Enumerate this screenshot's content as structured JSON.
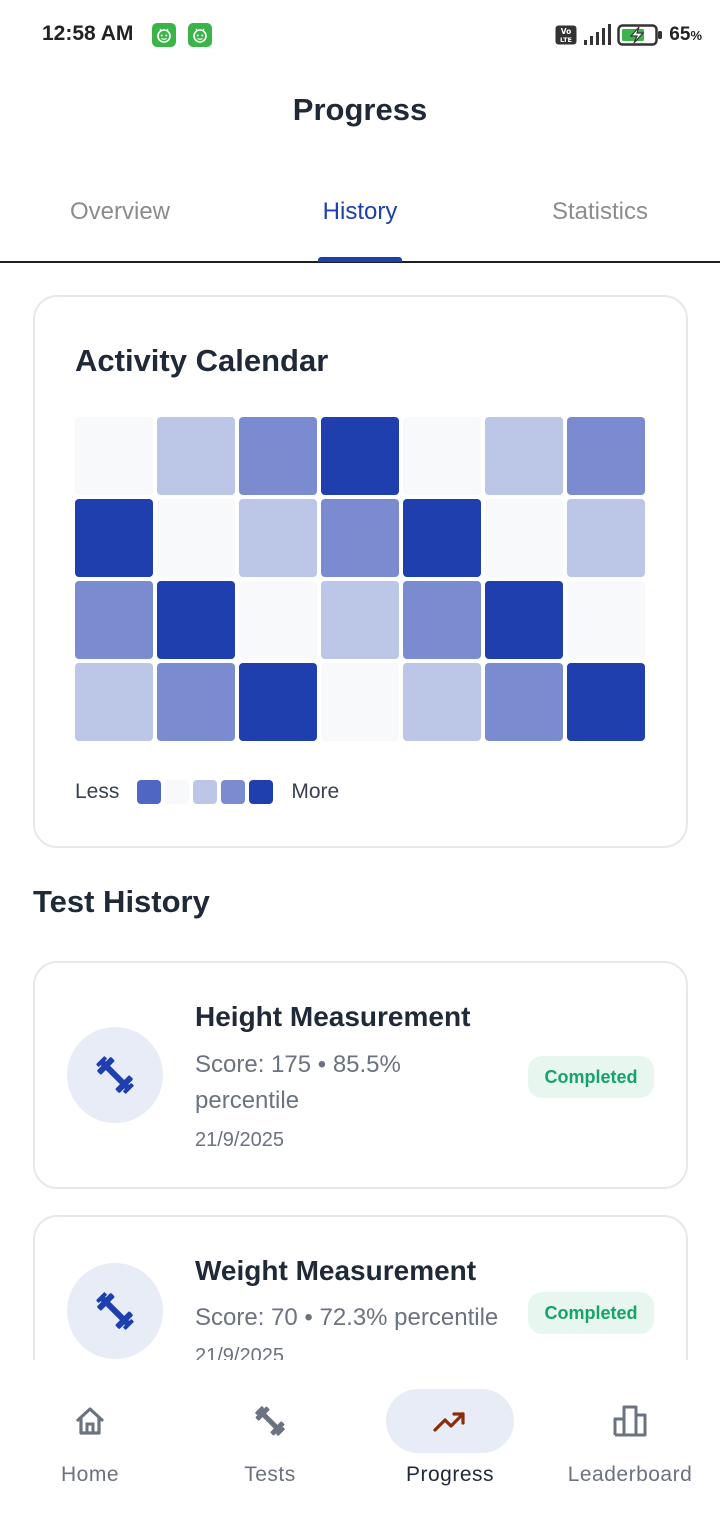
{
  "status_bar": {
    "time": "12:58 AM",
    "battery_percent": "65",
    "battery_unit": "%",
    "notification_icons": [
      "android-face-icon",
      "android-face-icon"
    ]
  },
  "header": {
    "title": "Progress"
  },
  "tabs": [
    {
      "label": "Overview",
      "active": false
    },
    {
      "label": "History",
      "active": true
    },
    {
      "label": "Statistics",
      "active": false
    }
  ],
  "activity_calendar": {
    "title": "Activity Calendar",
    "levels": [
      [
        0,
        1,
        2,
        3,
        0,
        1,
        2
      ],
      [
        3,
        0,
        1,
        2,
        3,
        0,
        1
      ],
      [
        2,
        3,
        0,
        1,
        2,
        3,
        0
      ],
      [
        1,
        2,
        3,
        0,
        1,
        2,
        3
      ]
    ],
    "level_colors": [
      "#f8f9fb",
      "#bcc6e7",
      "#7a8ccf",
      "#1f3fae"
    ],
    "legend": {
      "less_label": "Less",
      "more_label": "More",
      "swatch_colors": [
        "#4f66c2",
        "#f8f9fb",
        "#bcc6e7",
        "#7a8ccf",
        "#1f3fae"
      ]
    }
  },
  "test_history": {
    "title": "Test History",
    "items": [
      {
        "name": "Height Measurement",
        "score": "Score: 175 • 85.5% percentile",
        "date": "21/9/2025",
        "status": "Completed",
        "icon": "dumbbell-icon"
      },
      {
        "name": "Weight Measurement",
        "score": "Score: 70 • 72.3% percentile",
        "date": "21/9/2025",
        "status": "Completed",
        "icon": "dumbbell-icon"
      }
    ]
  },
  "bottom_nav": [
    {
      "label": "Home",
      "icon": "home-icon",
      "active": false
    },
    {
      "label": "Tests",
      "icon": "dumbbell-icon",
      "active": false
    },
    {
      "label": "Progress",
      "icon": "trending-up-icon",
      "active": true
    },
    {
      "label": "Leaderboard",
      "icon": "leaderboard-icon",
      "active": false
    }
  ],
  "colors": {
    "accent": "#1e40af",
    "progress_icon": "#8a2c0a",
    "badge_text": "#16a36a",
    "badge_bg": "#e7f7ef"
  }
}
